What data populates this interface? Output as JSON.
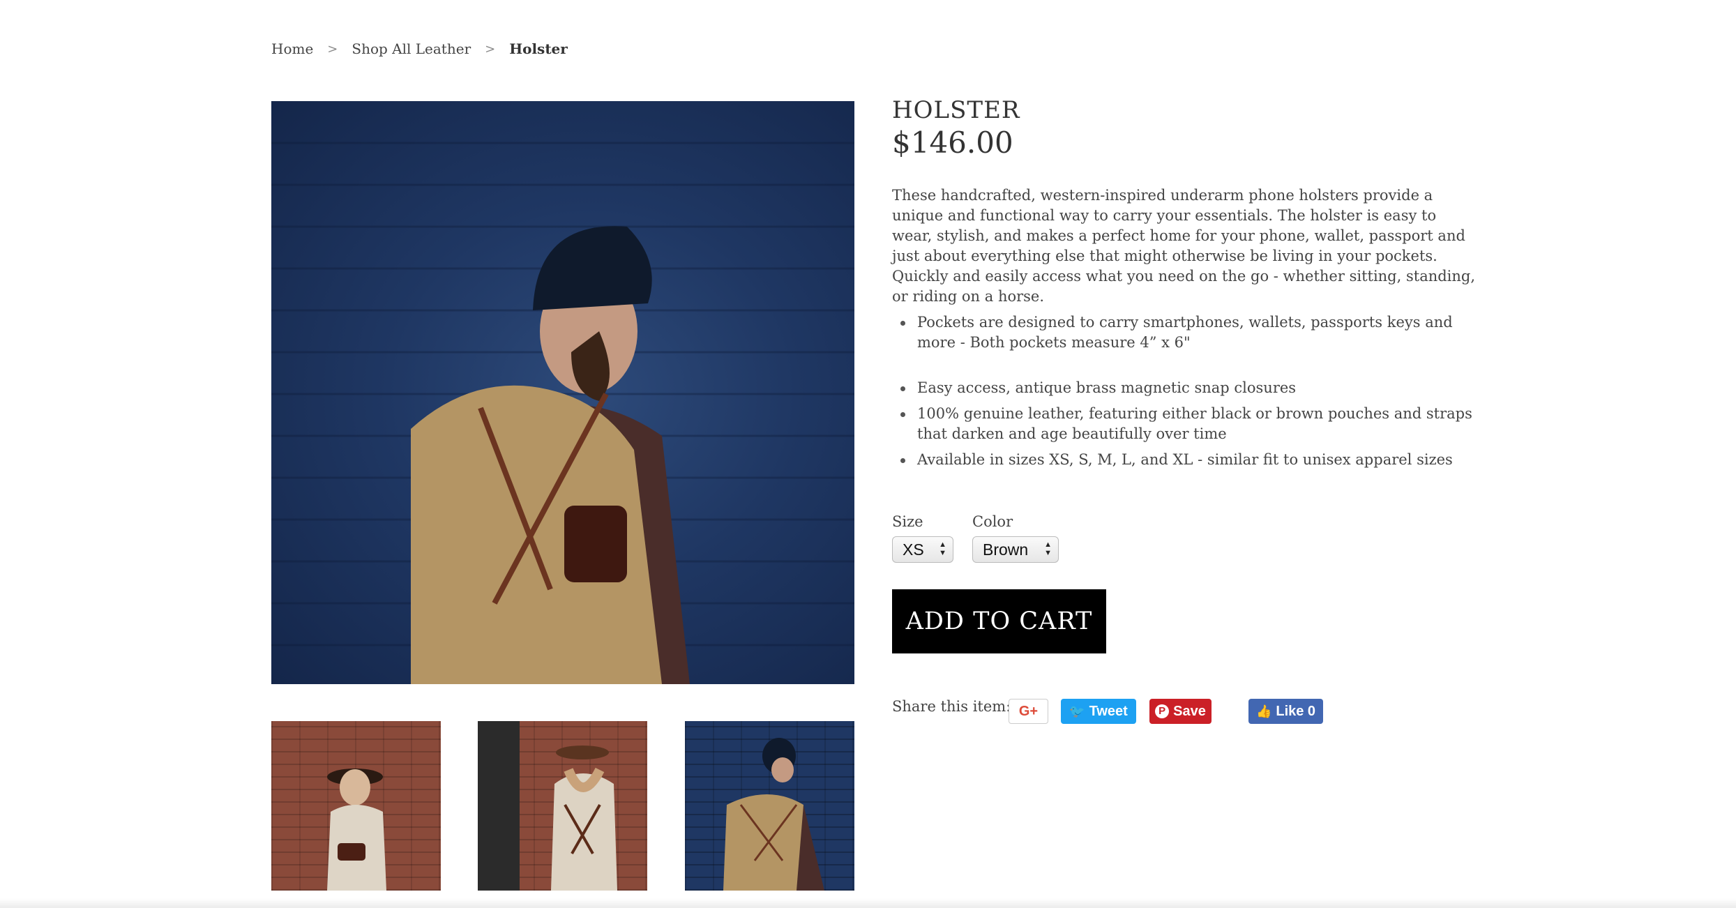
{
  "breadcrumb": {
    "home": "Home",
    "separator": ">",
    "category": "Shop All Leather",
    "current": "Holster"
  },
  "product": {
    "title": "HOLSTER",
    "price": "$146.00",
    "description": "These handcrafted, western-inspired underarm phone holsters provide a unique and functional way to carry your essentials. The holster is easy to wear, stylish, and makes a perfect home for your phone, wallet, passport and just about everything else that might otherwise be living in your pockets. Quickly and easily access what you need on the go - whether sitting, standing, or riding on a horse.",
    "features": [
      "Pockets are designed to carry smartphones, wallets, passports keys and more - Both pockets measure 4” x 6\"",
      "Easy access, antique brass magnetic snap closures",
      "100% genuine leather, featuring either black or brown pouches and straps that darken and age beautifully over time",
      "Available in sizes XS, S, M, L, and XL - similar fit to unisex apparel sizes"
    ]
  },
  "options": {
    "size_label": "Size",
    "size_value": "XS",
    "color_label": "Color",
    "color_value": "Brown"
  },
  "cart": {
    "add_label": "ADD TO CART"
  },
  "share": {
    "label": "Share this item:",
    "gplus": "G+",
    "tweet": "Tweet",
    "pin": "Save",
    "fb": "Like 0"
  },
  "colors": {
    "button_black": "#000000",
    "twitter": "#1da1f2",
    "pinterest": "#cb2027",
    "facebook": "#4267b2"
  }
}
